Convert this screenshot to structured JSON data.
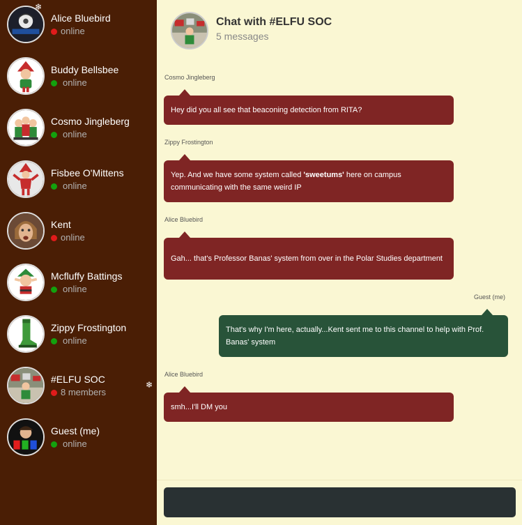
{
  "sidebar": {
    "contacts": [
      {
        "name": "Alice Bluebird",
        "status": "online",
        "status_color": "#e01b1b",
        "avatar": "alice-bluebird-avatar"
      },
      {
        "name": "Buddy Bellsbee",
        "status": "online",
        "status_color": "#13a10e",
        "avatar": "elf-avatar"
      },
      {
        "name": "Cosmo Jingleberg",
        "status": "online",
        "status_color": "#13a10e",
        "avatar": "elf-group-avatar"
      },
      {
        "name": "Fisbee O'Mittens",
        "status": "online",
        "status_color": "#13a10e",
        "avatar": "elf-avatar"
      },
      {
        "name": "Kent",
        "status": "online",
        "status_color": "#e01b1b",
        "avatar": "kent-avatar"
      },
      {
        "name": "Mcfluffy Battings",
        "status": "online",
        "status_color": "#13a10e",
        "avatar": "elf-avatar"
      },
      {
        "name": "Zippy Frostington",
        "status": "online",
        "status_color": "#13a10e",
        "avatar": "elf-boot-avatar"
      },
      {
        "name": "#ELFU SOC",
        "status": "8 members",
        "status_color": "#e01b1b",
        "avatar": "elfu-soc-avatar"
      },
      {
        "name": "Guest (me)",
        "status": "online",
        "status_color": "#13a10e",
        "avatar": "hhc-avatar"
      }
    ],
    "snowflake_icon": "❄"
  },
  "header": {
    "title": "Chat with #ELFU SOC",
    "subtitle": "5 messages"
  },
  "messages": [
    {
      "sender": "Cosmo Jingleberg",
      "text": "Hey did you all see that beaconing detection from RITA?",
      "color": "#7f2524",
      "own": false
    },
    {
      "sender": "Zippy Frostington",
      "text_before": "Yep. And we have some system called ",
      "text_bold": "'sweetums'",
      "text_after": " here on campus communicating with the same weird IP",
      "color": "#7f2524",
      "own": false
    },
    {
      "sender": "Alice Bluebird",
      "text": "Gah... that's Professor Banas' system from over in the Polar Studies department",
      "color": "#7f2524",
      "own": false
    },
    {
      "sender": "Guest (me)",
      "text": "That's why I'm here, actually...Kent sent me to this channel to help with Prof. Banas' system",
      "color": "#285339",
      "own": true
    },
    {
      "sender": "Alice Bluebird",
      "text": "smh...I'll DM you",
      "color": "#7f2524",
      "own": false
    }
  ],
  "composer": {
    "value": "",
    "placeholder": ""
  },
  "colors": {
    "sidebar_bg": "#4a1e05",
    "chat_bg": "#faf7d3",
    "input_bg": "#293133",
    "online_green": "#13a10e",
    "alert_red": "#e01b1b"
  }
}
